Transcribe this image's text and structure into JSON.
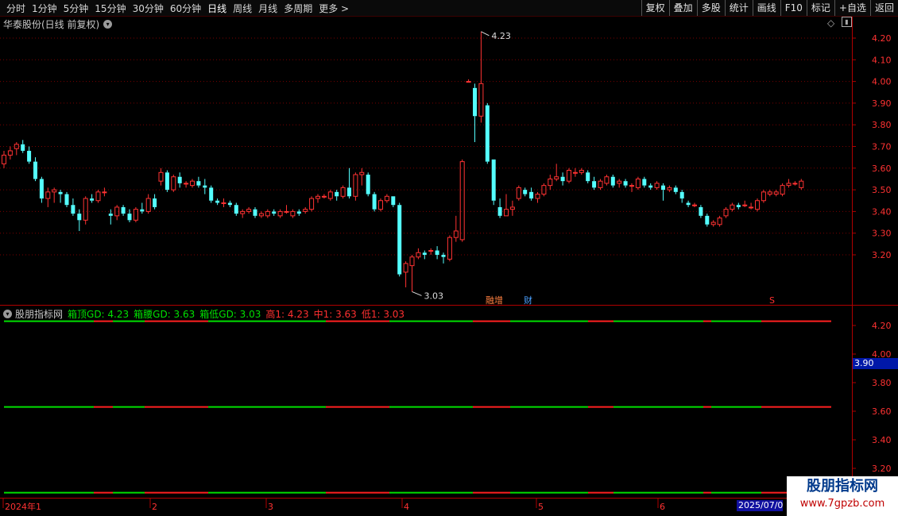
{
  "toolbar": {
    "periods": [
      "分时",
      "1分钟",
      "5分钟",
      "15分钟",
      "30分钟",
      "60分钟",
      "日线",
      "周线",
      "月线",
      "多周期",
      "更多 >"
    ],
    "active_period": "日线",
    "buttons": [
      "复权",
      "叠加",
      "多股",
      "统计",
      "画线",
      "F10",
      "标记",
      "+自选",
      "返回"
    ]
  },
  "main_panel": {
    "title": "华泰股份(日线 前复权)",
    "y_ticks": [
      "4.20",
      "4.10",
      "4.00",
      "3.90",
      "3.80",
      "3.70",
      "3.60",
      "3.50",
      "3.40",
      "3.30",
      "3.20"
    ],
    "high_marker": "4.23",
    "low_marker": "3.03",
    "event_tags": [
      "融增",
      "财",
      "S"
    ]
  },
  "indicator_panel": {
    "name": "股朋指标网",
    "values": [
      {
        "label": "箱顶GD: 4.23",
        "color": "#00e000"
      },
      {
        "label": "箱腰GD: 3.63",
        "color": "#00e000"
      },
      {
        "label": "箱低GD: 3.03",
        "color": "#00e000"
      },
      {
        "label": "高1: 4.23",
        "color": "#ff3030"
      },
      {
        "label": "中1: 3.63",
        "color": "#ff3030"
      },
      {
        "label": "低1: 3.03",
        "color": "#ff3030"
      }
    ],
    "y_ticks": [
      "4.20",
      "4.00",
      "3.80",
      "3.60",
      "3.40",
      "3.20"
    ],
    "cursor_price": "3.90"
  },
  "date_axis": {
    "labels": [
      "2024年1",
      "2",
      "3",
      "4",
      "5",
      "6"
    ],
    "cursor_date": "2025/07/0"
  },
  "watermark": {
    "title": "股朋指标网",
    "url": "www.7gpzb.com"
  },
  "colors": {
    "up": "#ff3232",
    "down": "#54ffff",
    "grid": "#7a0000",
    "axis": "#b00000",
    "green_line": "#00e000",
    "red_line": "#ff2020"
  },
  "chart_data": {
    "type": "candlestick",
    "ylim": [
      3.0,
      4.28
    ],
    "candles": [
      {
        "o": 3.62,
        "h": 3.68,
        "l": 3.6,
        "c": 3.66
      },
      {
        "o": 3.66,
        "h": 3.7,
        "l": 3.64,
        "c": 3.68
      },
      {
        "o": 3.69,
        "h": 3.72,
        "l": 3.66,
        "c": 3.71
      },
      {
        "o": 3.71,
        "h": 3.73,
        "l": 3.67,
        "c": 3.68
      },
      {
        "o": 3.68,
        "h": 3.7,
        "l": 3.62,
        "c": 3.63
      },
      {
        "o": 3.63,
        "h": 3.65,
        "l": 3.54,
        "c": 3.55
      },
      {
        "o": 3.55,
        "h": 3.56,
        "l": 3.44,
        "c": 3.46
      },
      {
        "o": 3.46,
        "h": 3.51,
        "l": 3.42,
        "c": 3.49
      },
      {
        "o": 3.49,
        "h": 3.51,
        "l": 3.44,
        "c": 3.5
      },
      {
        "o": 3.49,
        "h": 3.5,
        "l": 3.44,
        "c": 3.48
      },
      {
        "o": 3.48,
        "h": 3.49,
        "l": 3.42,
        "c": 3.43
      },
      {
        "o": 3.43,
        "h": 3.46,
        "l": 3.38,
        "c": 3.39
      },
      {
        "o": 3.39,
        "h": 3.41,
        "l": 3.31,
        "c": 3.36
      },
      {
        "o": 3.36,
        "h": 3.47,
        "l": 3.34,
        "c": 3.46
      },
      {
        "o": 3.46,
        "h": 3.48,
        "l": 3.44,
        "c": 3.45
      },
      {
        "o": 3.45,
        "h": 3.5,
        "l": 3.44,
        "c": 3.49
      },
      {
        "o": 3.49,
        "h": 3.51,
        "l": 3.47,
        "c": 3.49
      },
      {
        "o": 3.39,
        "h": 3.41,
        "l": 3.34,
        "c": 3.38
      },
      {
        "o": 3.38,
        "h": 3.43,
        "l": 3.36,
        "c": 3.42
      },
      {
        "o": 3.42,
        "h": 3.43,
        "l": 3.38,
        "c": 3.39
      },
      {
        "o": 3.39,
        "h": 3.41,
        "l": 3.35,
        "c": 3.36
      },
      {
        "o": 3.36,
        "h": 3.42,
        "l": 3.35,
        "c": 3.41
      },
      {
        "o": 3.41,
        "h": 3.44,
        "l": 3.39,
        "c": 3.4
      },
      {
        "o": 3.4,
        "h": 3.48,
        "l": 3.39,
        "c": 3.46
      },
      {
        "o": 3.46,
        "h": 3.48,
        "l": 3.41,
        "c": 3.42
      },
      {
        "o": 3.54,
        "h": 3.6,
        "l": 3.52,
        "c": 3.58
      },
      {
        "o": 3.58,
        "h": 3.59,
        "l": 3.49,
        "c": 3.5
      },
      {
        "o": 3.5,
        "h": 3.57,
        "l": 3.49,
        "c": 3.56
      },
      {
        "o": 3.56,
        "h": 3.58,
        "l": 3.51,
        "c": 3.53
      },
      {
        "o": 3.53,
        "h": 3.54,
        "l": 3.51,
        "c": 3.53
      },
      {
        "o": 3.52,
        "h": 3.55,
        "l": 3.51,
        "c": 3.54
      },
      {
        "o": 3.54,
        "h": 3.56,
        "l": 3.51,
        "c": 3.52
      },
      {
        "o": 3.52,
        "h": 3.55,
        "l": 3.48,
        "c": 3.51
      },
      {
        "o": 3.51,
        "h": 3.52,
        "l": 3.44,
        "c": 3.45
      },
      {
        "o": 3.45,
        "h": 3.46,
        "l": 3.43,
        "c": 3.44
      },
      {
        "o": 3.44,
        "h": 3.46,
        "l": 3.42,
        "c": 3.44
      },
      {
        "o": 3.44,
        "h": 3.45,
        "l": 3.42,
        "c": 3.43
      },
      {
        "o": 3.43,
        "h": 3.44,
        "l": 3.38,
        "c": 3.39
      },
      {
        "o": 3.39,
        "h": 3.41,
        "l": 3.37,
        "c": 3.4
      },
      {
        "o": 3.4,
        "h": 3.42,
        "l": 3.39,
        "c": 3.41
      },
      {
        "o": 3.41,
        "h": 3.42,
        "l": 3.37,
        "c": 3.38
      },
      {
        "o": 3.38,
        "h": 3.4,
        "l": 3.37,
        "c": 3.39
      },
      {
        "o": 3.38,
        "h": 3.41,
        "l": 3.37,
        "c": 3.4
      },
      {
        "o": 3.4,
        "h": 3.41,
        "l": 3.38,
        "c": 3.39
      },
      {
        "o": 3.38,
        "h": 3.41,
        "l": 3.37,
        "c": 3.4
      },
      {
        "o": 3.4,
        "h": 3.43,
        "l": 3.39,
        "c": 3.4
      },
      {
        "o": 3.38,
        "h": 3.41,
        "l": 3.37,
        "c": 3.4
      },
      {
        "o": 3.4,
        "h": 3.41,
        "l": 3.38,
        "c": 3.39
      },
      {
        "o": 3.4,
        "h": 3.42,
        "l": 3.39,
        "c": 3.41
      },
      {
        "o": 3.41,
        "h": 3.47,
        "l": 3.4,
        "c": 3.46
      },
      {
        "o": 3.46,
        "h": 3.48,
        "l": 3.44,
        "c": 3.47
      },
      {
        "o": 3.47,
        "h": 3.48,
        "l": 3.46,
        "c": 3.47
      },
      {
        "o": 3.46,
        "h": 3.5,
        "l": 3.45,
        "c": 3.49
      },
      {
        "o": 3.49,
        "h": 3.5,
        "l": 3.45,
        "c": 3.47
      },
      {
        "o": 3.47,
        "h": 3.52,
        "l": 3.46,
        "c": 3.51
      },
      {
        "o": 3.51,
        "h": 3.6,
        "l": 3.46,
        "c": 3.47
      },
      {
        "o": 3.47,
        "h": 3.58,
        "l": 3.45,
        "c": 3.57
      },
      {
        "o": 3.57,
        "h": 3.6,
        "l": 3.52,
        "c": 3.58
      },
      {
        "o": 3.57,
        "h": 3.58,
        "l": 3.47,
        "c": 3.48
      },
      {
        "o": 3.48,
        "h": 3.49,
        "l": 3.4,
        "c": 3.41
      },
      {
        "o": 3.41,
        "h": 3.46,
        "l": 3.4,
        "c": 3.45
      },
      {
        "o": 3.45,
        "h": 3.48,
        "l": 3.44,
        "c": 3.47
      },
      {
        "o": 3.47,
        "h": 3.47,
        "l": 3.42,
        "c": 3.43
      },
      {
        "o": 3.43,
        "h": 3.44,
        "l": 3.1,
        "c": 3.11
      },
      {
        "o": 3.12,
        "h": 3.17,
        "l": 3.05,
        "c": 3.16
      },
      {
        "o": 3.15,
        "h": 3.2,
        "l": 3.03,
        "c": 3.19
      },
      {
        "o": 3.19,
        "h": 3.23,
        "l": 3.18,
        "c": 3.21
      },
      {
        "o": 3.21,
        "h": 3.22,
        "l": 3.18,
        "c": 3.2
      },
      {
        "o": 3.22,
        "h": 3.23,
        "l": 3.2,
        "c": 3.22
      },
      {
        "o": 3.22,
        "h": 3.24,
        "l": 3.18,
        "c": 3.2
      },
      {
        "o": 3.2,
        "h": 3.21,
        "l": 3.16,
        "c": 3.19
      },
      {
        "o": 3.18,
        "h": 3.29,
        "l": 3.17,
        "c": 3.28
      },
      {
        "o": 3.28,
        "h": 3.38,
        "l": 3.26,
        "c": 3.31
      },
      {
        "o": 3.27,
        "h": 3.64,
        "l": 3.26,
        "c": 3.63
      },
      {
        "o": 4.0,
        "h": 4.01,
        "l": 4.0,
        "c": 4.0
      },
      {
        "o": 3.97,
        "h": 3.99,
        "l": 3.72,
        "c": 3.84
      },
      {
        "o": 3.84,
        "h": 4.23,
        "l": 3.81,
        "c": 3.99
      },
      {
        "o": 3.89,
        "h": 3.9,
        "l": 3.62,
        "c": 3.63
      },
      {
        "o": 3.64,
        "h": 3.64,
        "l": 3.43,
        "c": 3.45
      },
      {
        "o": 3.42,
        "h": 3.46,
        "l": 3.37,
        "c": 3.38
      },
      {
        "o": 3.38,
        "h": 3.48,
        "l": 3.38,
        "c": 3.41
      },
      {
        "o": 3.41,
        "h": 3.45,
        "l": 3.38,
        "c": 3.42
      },
      {
        "o": 3.46,
        "h": 3.52,
        "l": 3.45,
        "c": 3.51
      },
      {
        "o": 3.5,
        "h": 3.51,
        "l": 3.47,
        "c": 3.48
      },
      {
        "o": 3.49,
        "h": 3.51,
        "l": 3.45,
        "c": 3.46
      },
      {
        "o": 3.46,
        "h": 3.49,
        "l": 3.44,
        "c": 3.48
      },
      {
        "o": 3.48,
        "h": 3.53,
        "l": 3.47,
        "c": 3.52
      },
      {
        "o": 3.52,
        "h": 3.57,
        "l": 3.5,
        "c": 3.55
      },
      {
        "o": 3.55,
        "h": 3.62,
        "l": 3.54,
        "c": 3.56
      },
      {
        "o": 3.56,
        "h": 3.58,
        "l": 3.52,
        "c": 3.54
      },
      {
        "o": 3.54,
        "h": 3.6,
        "l": 3.53,
        "c": 3.59
      },
      {
        "o": 3.58,
        "h": 3.6,
        "l": 3.56,
        "c": 3.58
      },
      {
        "o": 3.58,
        "h": 3.6,
        "l": 3.57,
        "c": 3.59
      },
      {
        "o": 3.58,
        "h": 3.59,
        "l": 3.53,
        "c": 3.54
      },
      {
        "o": 3.54,
        "h": 3.56,
        "l": 3.5,
        "c": 3.51
      },
      {
        "o": 3.51,
        "h": 3.55,
        "l": 3.5,
        "c": 3.54
      },
      {
        "o": 3.53,
        "h": 3.57,
        "l": 3.52,
        "c": 3.56
      },
      {
        "o": 3.56,
        "h": 3.57,
        "l": 3.51,
        "c": 3.52
      },
      {
        "o": 3.53,
        "h": 3.55,
        "l": 3.51,
        "c": 3.54
      },
      {
        "o": 3.54,
        "h": 3.55,
        "l": 3.51,
        "c": 3.52
      },
      {
        "o": 3.52,
        "h": 3.53,
        "l": 3.49,
        "c": 3.52
      },
      {
        "o": 3.51,
        "h": 3.56,
        "l": 3.5,
        "c": 3.55
      },
      {
        "o": 3.55,
        "h": 3.56,
        "l": 3.51,
        "c": 3.52
      },
      {
        "o": 3.52,
        "h": 3.53,
        "l": 3.5,
        "c": 3.51
      },
      {
        "o": 3.51,
        "h": 3.54,
        "l": 3.5,
        "c": 3.53
      },
      {
        "o": 3.52,
        "h": 3.53,
        "l": 3.45,
        "c": 3.5
      },
      {
        "o": 3.5,
        "h": 3.52,
        "l": 3.49,
        "c": 3.51
      },
      {
        "o": 3.51,
        "h": 3.52,
        "l": 3.48,
        "c": 3.49
      },
      {
        "o": 3.49,
        "h": 3.5,
        "l": 3.44,
        "c": 3.46
      },
      {
        "o": 3.44,
        "h": 3.45,
        "l": 3.42,
        "c": 3.43
      },
      {
        "o": 3.43,
        "h": 3.44,
        "l": 3.42,
        "c": 3.43
      },
      {
        "o": 3.42,
        "h": 3.43,
        "l": 3.37,
        "c": 3.38
      },
      {
        "o": 3.38,
        "h": 3.39,
        "l": 3.33,
        "c": 3.34
      },
      {
        "o": 3.34,
        "h": 3.36,
        "l": 3.33,
        "c": 3.35
      },
      {
        "o": 3.34,
        "h": 3.38,
        "l": 3.33,
        "c": 3.37
      },
      {
        "o": 3.38,
        "h": 3.42,
        "l": 3.37,
        "c": 3.41
      },
      {
        "o": 3.41,
        "h": 3.44,
        "l": 3.4,
        "c": 3.43
      },
      {
        "o": 3.43,
        "h": 3.44,
        "l": 3.41,
        "c": 3.42
      },
      {
        "o": 3.43,
        "h": 3.45,
        "l": 3.42,
        "c": 3.43
      },
      {
        "o": 3.42,
        "h": 3.44,
        "l": 3.41,
        "c": 3.42
      },
      {
        "o": 3.41,
        "h": 3.46,
        "l": 3.4,
        "c": 3.45
      },
      {
        "o": 3.45,
        "h": 3.5,
        "l": 3.44,
        "c": 3.49
      },
      {
        "o": 3.48,
        "h": 3.5,
        "l": 3.47,
        "c": 3.49
      },
      {
        "o": 3.48,
        "h": 3.5,
        "l": 3.47,
        "c": 3.49
      },
      {
        "o": 3.48,
        "h": 3.53,
        "l": 3.47,
        "c": 3.52
      },
      {
        "o": 3.52,
        "h": 3.55,
        "l": 3.51,
        "c": 3.53
      },
      {
        "o": 3.53,
        "h": 3.54,
        "l": 3.52,
        "c": 3.53
      },
      {
        "o": 3.51,
        "h": 3.55,
        "l": 3.5,
        "c": 3.54
      }
    ],
    "indicator_lines": {
      "top": 4.23,
      "mid": 3.63,
      "low": 3.03
    }
  }
}
